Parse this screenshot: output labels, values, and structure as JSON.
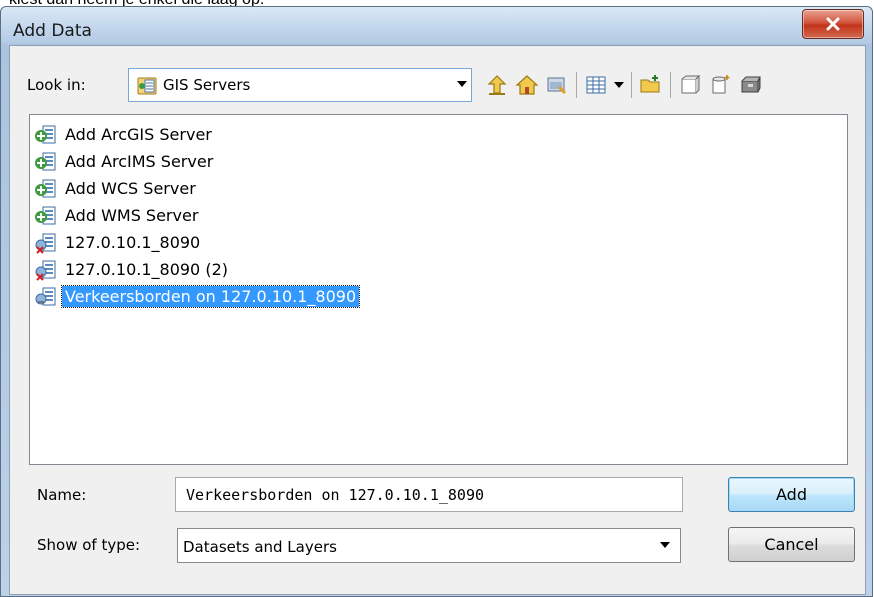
{
  "background_caption": "kiest dan neem je enkel die laag op.",
  "window": {
    "title": "Add Data",
    "close_glyph": "x"
  },
  "look_in": {
    "label": "Look in:",
    "value": "GIS Servers",
    "icon": "gis-servers-icon"
  },
  "toolbar": {
    "icons": [
      "up-one-level-icon",
      "home-icon",
      "connect-to-folder-icon",
      "toggle-contents-icon",
      "dropdown-arrow-icon",
      "new-folder-icon",
      "catalog-icon",
      "new-gdb-icon",
      "toolbox-icon"
    ]
  },
  "file_list": {
    "items": [
      {
        "label": "Add ArcGIS Server",
        "icon": "add-server-icon",
        "selected": false
      },
      {
        "label": "Add ArcIMS Server",
        "icon": "add-server-icon",
        "selected": false
      },
      {
        "label": "Add WCS Server",
        "icon": "add-server-icon",
        "selected": false
      },
      {
        "label": "Add WMS Server",
        "icon": "add-server-icon",
        "selected": false
      },
      {
        "label": "127.0.10.1_8090",
        "icon": "server-disconnected-icon",
        "selected": false
      },
      {
        "label": "127.0.10.1_8090 (2)",
        "icon": "server-disconnected-icon",
        "selected": false
      },
      {
        "label": "Verkeersborden on 127.0.10.1_8090",
        "icon": "server-connection-icon",
        "selected": true
      }
    ]
  },
  "name_field": {
    "label": "Name:",
    "value": "Verkeersborden on 127.0.10.1_8090"
  },
  "type_field": {
    "label": "Show of type:",
    "value": "Datasets and Layers"
  },
  "buttons": {
    "add": "Add",
    "cancel": "Cancel"
  },
  "colors": {
    "selection": "#3399ff",
    "close_button": "#c2341b"
  }
}
